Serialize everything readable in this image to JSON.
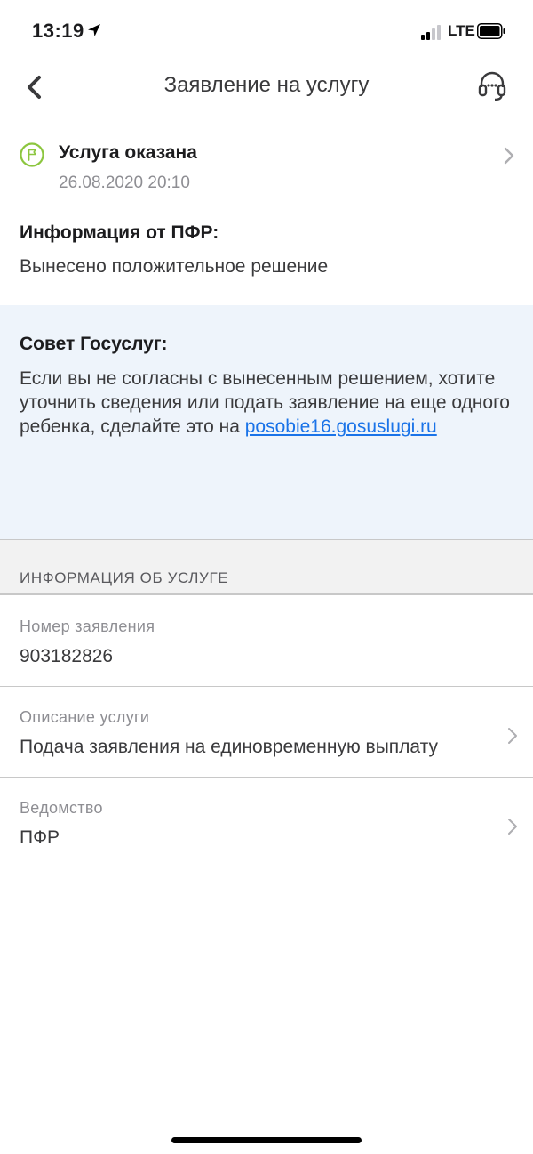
{
  "status_bar": {
    "time": "13:19",
    "network": "LTE"
  },
  "navbar": {
    "title": "Заявление на услугу",
    "back_icon": "chevron-left-icon",
    "support_icon": "headset-icon"
  },
  "application_status": {
    "title": "Услуга оказана",
    "date": "26.08.2020 20:10",
    "icon": "flag-icon",
    "icon_color": "#8cc63f"
  },
  "pfr_info": {
    "heading": "Информация от ПФР:",
    "text": "Вынесено положительное решение"
  },
  "advice": {
    "title": "Совет Госуслуг:",
    "text": "Если вы не согласны с вынесенным решением, хотите уточнить сведения или подать заявление на еще одного ребенка, сделайте это на ",
    "link": "posobie16.gosuslugi.ru",
    "background": "#eef4fb",
    "link_color": "#1a73e8"
  },
  "service_info": {
    "section_title": "ИНФОРМАЦИЯ ОБ УСЛУГЕ",
    "rows": [
      {
        "label": "Номер заявления",
        "value": "903182826"
      },
      {
        "label": "Описание услуги",
        "value": "Подача заявления на единовременную выплату"
      },
      {
        "label": "Ведомство",
        "value": "ПФР"
      }
    ]
  }
}
